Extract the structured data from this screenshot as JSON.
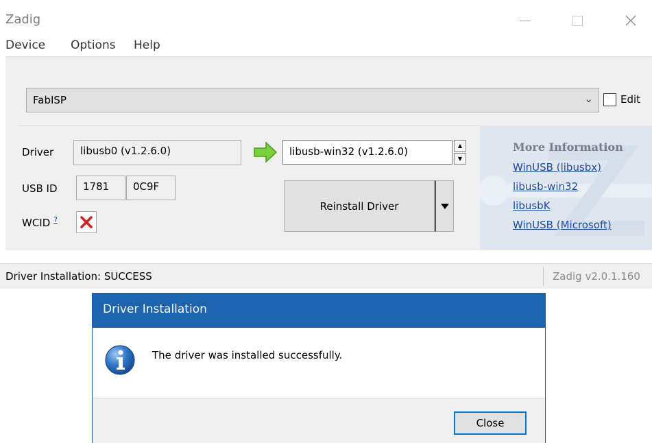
{
  "window": {
    "title": "Zadig",
    "minimize_icon": "minimize-icon",
    "maximize_icon": "maximize-icon",
    "close_icon": "close-icon"
  },
  "menu": {
    "items": [
      {
        "label": "Device"
      },
      {
        "label": "Options"
      },
      {
        "label": "Help"
      }
    ]
  },
  "device": {
    "selected": "FabISP",
    "edit_label": "Edit",
    "edit_checked": false
  },
  "driver": {
    "label": "Driver",
    "current": "libusb0 (v1.2.6.0)",
    "target": "libusb-win32 (v1.2.6.0)",
    "arrow_icon": "green-arrow-right-icon"
  },
  "usb_id": {
    "label": "USB ID",
    "vid": "1781",
    "pid": "0C9F"
  },
  "wcid": {
    "label": "WCID",
    "help_mark": "?",
    "status_icon": "red-x-icon"
  },
  "actions": {
    "reinstall_label": "Reinstall Driver"
  },
  "info": {
    "title": "More Information",
    "links": [
      {
        "label": "WinUSB (libusbx)"
      },
      {
        "label": "libusb-win32"
      },
      {
        "label": "libusbK"
      },
      {
        "label": "WinUSB (Microsoft)"
      }
    ],
    "link_color": "#1c4aa8"
  },
  "status": {
    "message": "Driver Installation: SUCCESS",
    "version": "Zadig v2.0.1.160"
  },
  "dialog": {
    "title": "Driver Installation",
    "message": "The driver was installed successfully.",
    "icon": "info-icon",
    "close_label": "Close",
    "title_color": "#1d64b0"
  }
}
